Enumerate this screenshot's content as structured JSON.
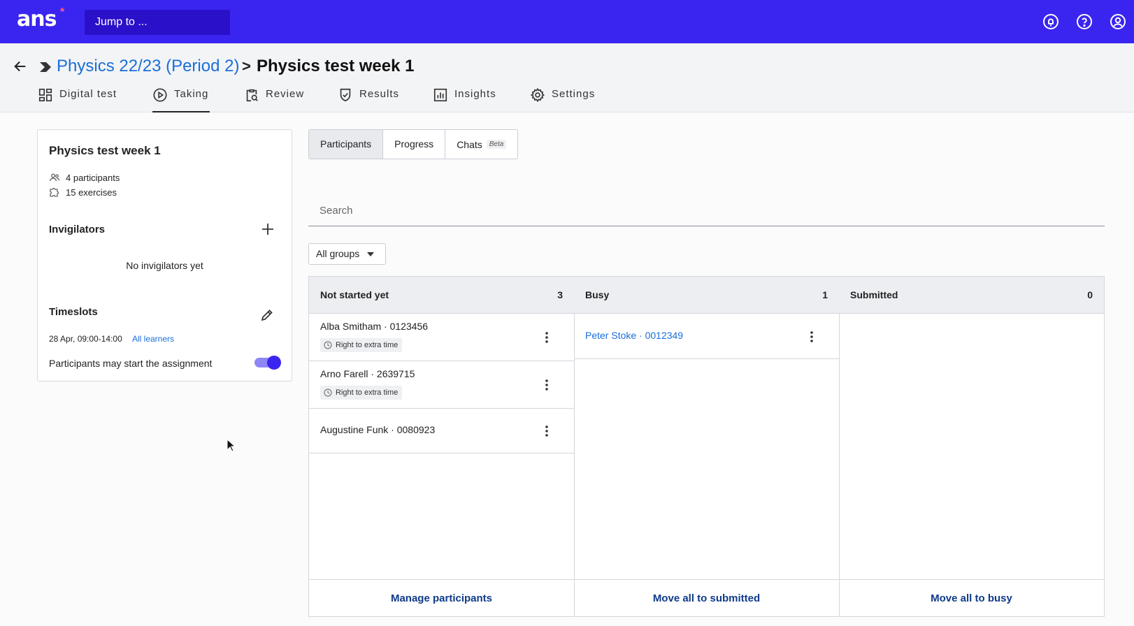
{
  "topbar": {
    "logo": "ans",
    "logo_mark": "*",
    "jump_placeholder": "Jump to ...",
    "icons": [
      "notifications-icon",
      "help-icon",
      "account-icon"
    ]
  },
  "breadcrumb": {
    "parent": "Physics 22/23 (Period 2)",
    "separator": ">",
    "current": "Physics test week 1"
  },
  "tabs": [
    {
      "label": "Digital test",
      "icon": "dashboard-icon"
    },
    {
      "label": "Taking",
      "icon": "play-icon",
      "active": true
    },
    {
      "label": "Review",
      "icon": "clipboard-search-icon"
    },
    {
      "label": "Results",
      "icon": "shield-check-icon"
    },
    {
      "label": "Insights",
      "icon": "chart-icon"
    },
    {
      "label": "Settings",
      "icon": "gear-icon"
    }
  ],
  "summary": {
    "title": "Physics test week 1",
    "participants": "4 participants",
    "exercises": "15 exercises",
    "invigilators_label": "Invigilators",
    "invigilators_empty": "No invigilators yet",
    "timeslots_label": "Timeslots",
    "timeslot_time": "28 Apr, 09:00-14:00",
    "timeslot_scope": "All learners",
    "start_label": "Participants may start the assignment",
    "start_enabled": true
  },
  "view_tabs": [
    {
      "label": "Participants",
      "active": true
    },
    {
      "label": "Progress"
    },
    {
      "label": "Chats",
      "badge": "Beta"
    }
  ],
  "search": {
    "placeholder": "Search"
  },
  "group_filter": {
    "selected": "All groups"
  },
  "columns": [
    {
      "title": "Not started yet",
      "count": "3",
      "footer": "Manage participants",
      "rows": [
        {
          "name": "Alba Smitham · 0123456",
          "tag": "Right to extra time"
        },
        {
          "name": "Arno Farell · 2639715",
          "tag": "Right to extra time"
        },
        {
          "name": "Augustine Funk · 0080923"
        }
      ]
    },
    {
      "title": "Busy",
      "count": "1",
      "footer": "Move all to submitted",
      "rows": [
        {
          "name": "Peter Stoke · 0012349"
        }
      ]
    },
    {
      "title": "Submitted",
      "count": "0",
      "footer": "Move all to busy",
      "rows": []
    }
  ],
  "colors": {
    "brand": "#3a25f0",
    "link": "#1a6ed8",
    "footer_link": "#0f3a8a"
  }
}
